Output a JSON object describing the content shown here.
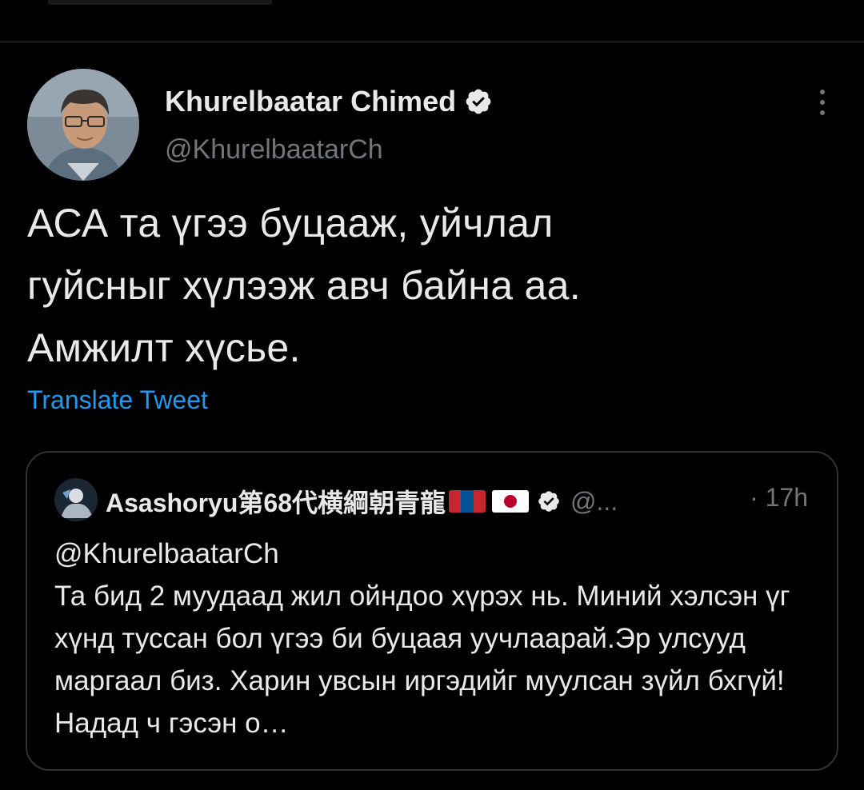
{
  "tweet": {
    "author": {
      "name": "Khurelbaatar Chimed",
      "handle": "@KhurelbaatarCh",
      "verified": true
    },
    "text": "АСА та үгээ буцааж, уйчлал\nгуйсныг хүлээж авч байна аа.\nАмжилт хүсье.",
    "translate_label": "Translate Tweet",
    "more_icon": "more-vertical-icon"
  },
  "quote": {
    "author": {
      "name": "Asashoryu第68代横綱朝青龍",
      "handle": "@...",
      "verified": true,
      "flags": [
        "mongolia-flag",
        "japan-flag"
      ]
    },
    "time": "· 17h",
    "mention": "@KhurelbaatarCh",
    "text": "Та бид 2 муудаад жил ойндоо хүрэх нь. Миний хэлсэн үг хүнд туссан бол үгээ би буцаая уучлаарай.Эр улсууд маргаал биз. Харин увсын иргэдийг муулсан зүйл бхгүй! Надад ч гэсэн о…"
  },
  "colors": {
    "background": "#000000",
    "text": "#e7e9ea",
    "secondary": "#71767b",
    "link": "#1d9bf0",
    "border": "#2f3336"
  }
}
